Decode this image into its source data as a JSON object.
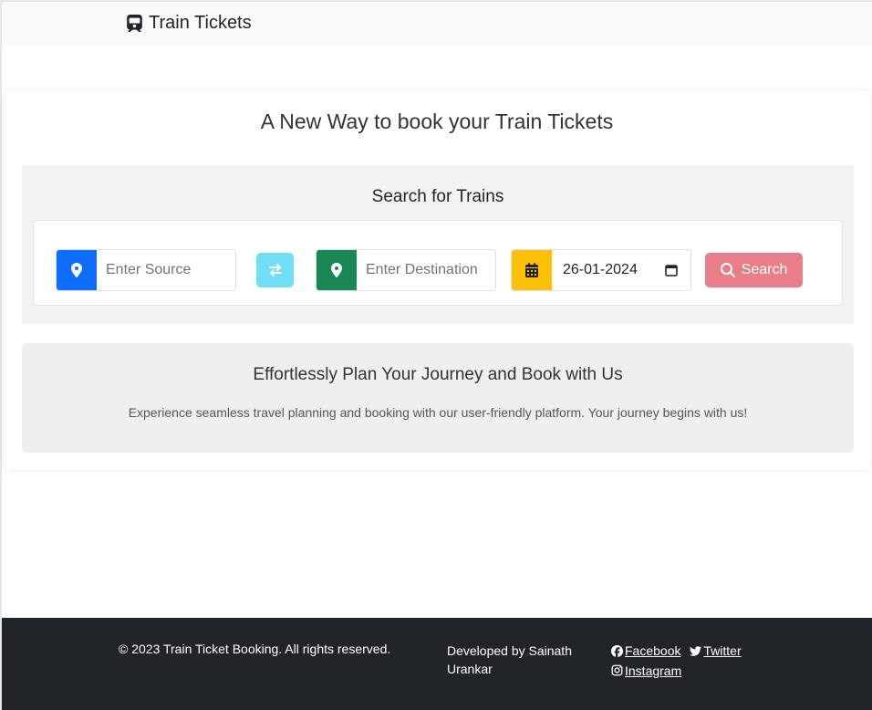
{
  "navbar": {
    "brand": "Train Tickets",
    "brand_icon": "train-icon"
  },
  "main": {
    "title": "A New Way to book your Train Tickets",
    "search": {
      "title": "Search for Trains",
      "source": {
        "placeholder": "Enter Source",
        "value": "",
        "icon": "map-marker-icon",
        "color": "#0d6efd"
      },
      "swap": {
        "icon": "swap-arrows-icon",
        "color": "#6edff6"
      },
      "destination": {
        "placeholder": "Enter Destination",
        "value": "",
        "icon": "map-marker-icon",
        "color": "#198754"
      },
      "date": {
        "value": "26-01-2024",
        "icon": "calendar-icon",
        "color": "#ffc107"
      },
      "search_button": {
        "label": "Search",
        "icon": "search-icon",
        "color": "#e77e89"
      }
    },
    "info": {
      "title": "Effortlessly Plan Your Journey and Book with Us",
      "text": "Experience seamless travel planning and booking with our user-friendly platform. Your journey begins with us!"
    }
  },
  "footer": {
    "copyright": "© 2023 Train Ticket Booking. All rights reserved.",
    "developer": "Developed by Sainath Urankar",
    "links": [
      {
        "label": " Facebook",
        "icon": "facebook-icon"
      },
      {
        "label": " Twitter",
        "icon": "twitter-icon"
      },
      {
        "label": " Instagram",
        "icon": "instagram-icon"
      }
    ]
  }
}
